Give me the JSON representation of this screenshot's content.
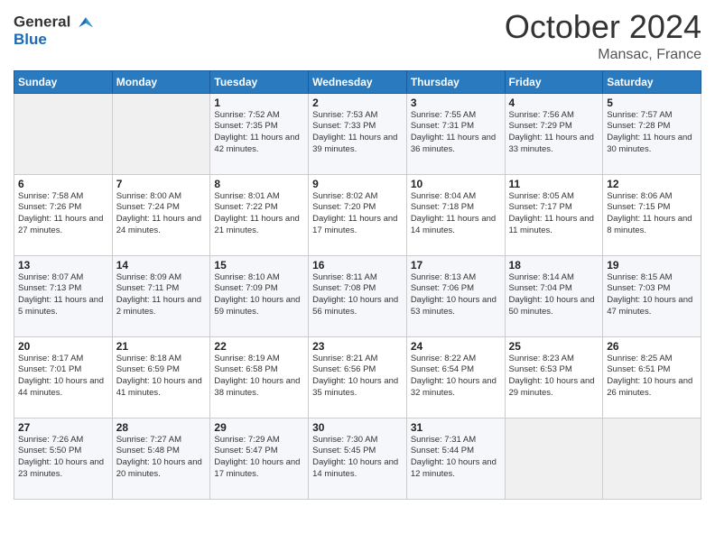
{
  "header": {
    "logo_line1": "General",
    "logo_line2": "Blue",
    "month": "October 2024",
    "location": "Mansac, France"
  },
  "weekdays": [
    "Sunday",
    "Monday",
    "Tuesday",
    "Wednesday",
    "Thursday",
    "Friday",
    "Saturday"
  ],
  "weeks": [
    [
      {
        "day": "",
        "info": ""
      },
      {
        "day": "",
        "info": ""
      },
      {
        "day": "1",
        "info": "Sunrise: 7:52 AM\nSunset: 7:35 PM\nDaylight: 11 hours and 42 minutes."
      },
      {
        "day": "2",
        "info": "Sunrise: 7:53 AM\nSunset: 7:33 PM\nDaylight: 11 hours and 39 minutes."
      },
      {
        "day": "3",
        "info": "Sunrise: 7:55 AM\nSunset: 7:31 PM\nDaylight: 11 hours and 36 minutes."
      },
      {
        "day": "4",
        "info": "Sunrise: 7:56 AM\nSunset: 7:29 PM\nDaylight: 11 hours and 33 minutes."
      },
      {
        "day": "5",
        "info": "Sunrise: 7:57 AM\nSunset: 7:28 PM\nDaylight: 11 hours and 30 minutes."
      }
    ],
    [
      {
        "day": "6",
        "info": "Sunrise: 7:58 AM\nSunset: 7:26 PM\nDaylight: 11 hours and 27 minutes."
      },
      {
        "day": "7",
        "info": "Sunrise: 8:00 AM\nSunset: 7:24 PM\nDaylight: 11 hours and 24 minutes."
      },
      {
        "day": "8",
        "info": "Sunrise: 8:01 AM\nSunset: 7:22 PM\nDaylight: 11 hours and 21 minutes."
      },
      {
        "day": "9",
        "info": "Sunrise: 8:02 AM\nSunset: 7:20 PM\nDaylight: 11 hours and 17 minutes."
      },
      {
        "day": "10",
        "info": "Sunrise: 8:04 AM\nSunset: 7:18 PM\nDaylight: 11 hours and 14 minutes."
      },
      {
        "day": "11",
        "info": "Sunrise: 8:05 AM\nSunset: 7:17 PM\nDaylight: 11 hours and 11 minutes."
      },
      {
        "day": "12",
        "info": "Sunrise: 8:06 AM\nSunset: 7:15 PM\nDaylight: 11 hours and 8 minutes."
      }
    ],
    [
      {
        "day": "13",
        "info": "Sunrise: 8:07 AM\nSunset: 7:13 PM\nDaylight: 11 hours and 5 minutes."
      },
      {
        "day": "14",
        "info": "Sunrise: 8:09 AM\nSunset: 7:11 PM\nDaylight: 11 hours and 2 minutes."
      },
      {
        "day": "15",
        "info": "Sunrise: 8:10 AM\nSunset: 7:09 PM\nDaylight: 10 hours and 59 minutes."
      },
      {
        "day": "16",
        "info": "Sunrise: 8:11 AM\nSunset: 7:08 PM\nDaylight: 10 hours and 56 minutes."
      },
      {
        "day": "17",
        "info": "Sunrise: 8:13 AM\nSunset: 7:06 PM\nDaylight: 10 hours and 53 minutes."
      },
      {
        "day": "18",
        "info": "Sunrise: 8:14 AM\nSunset: 7:04 PM\nDaylight: 10 hours and 50 minutes."
      },
      {
        "day": "19",
        "info": "Sunrise: 8:15 AM\nSunset: 7:03 PM\nDaylight: 10 hours and 47 minutes."
      }
    ],
    [
      {
        "day": "20",
        "info": "Sunrise: 8:17 AM\nSunset: 7:01 PM\nDaylight: 10 hours and 44 minutes."
      },
      {
        "day": "21",
        "info": "Sunrise: 8:18 AM\nSunset: 6:59 PM\nDaylight: 10 hours and 41 minutes."
      },
      {
        "day": "22",
        "info": "Sunrise: 8:19 AM\nSunset: 6:58 PM\nDaylight: 10 hours and 38 minutes."
      },
      {
        "day": "23",
        "info": "Sunrise: 8:21 AM\nSunset: 6:56 PM\nDaylight: 10 hours and 35 minutes."
      },
      {
        "day": "24",
        "info": "Sunrise: 8:22 AM\nSunset: 6:54 PM\nDaylight: 10 hours and 32 minutes."
      },
      {
        "day": "25",
        "info": "Sunrise: 8:23 AM\nSunset: 6:53 PM\nDaylight: 10 hours and 29 minutes."
      },
      {
        "day": "26",
        "info": "Sunrise: 8:25 AM\nSunset: 6:51 PM\nDaylight: 10 hours and 26 minutes."
      }
    ],
    [
      {
        "day": "27",
        "info": "Sunrise: 7:26 AM\nSunset: 5:50 PM\nDaylight: 10 hours and 23 minutes."
      },
      {
        "day": "28",
        "info": "Sunrise: 7:27 AM\nSunset: 5:48 PM\nDaylight: 10 hours and 20 minutes."
      },
      {
        "day": "29",
        "info": "Sunrise: 7:29 AM\nSunset: 5:47 PM\nDaylight: 10 hours and 17 minutes."
      },
      {
        "day": "30",
        "info": "Sunrise: 7:30 AM\nSunset: 5:45 PM\nDaylight: 10 hours and 14 minutes."
      },
      {
        "day": "31",
        "info": "Sunrise: 7:31 AM\nSunset: 5:44 PM\nDaylight: 10 hours and 12 minutes."
      },
      {
        "day": "",
        "info": ""
      },
      {
        "day": "",
        "info": ""
      }
    ]
  ]
}
